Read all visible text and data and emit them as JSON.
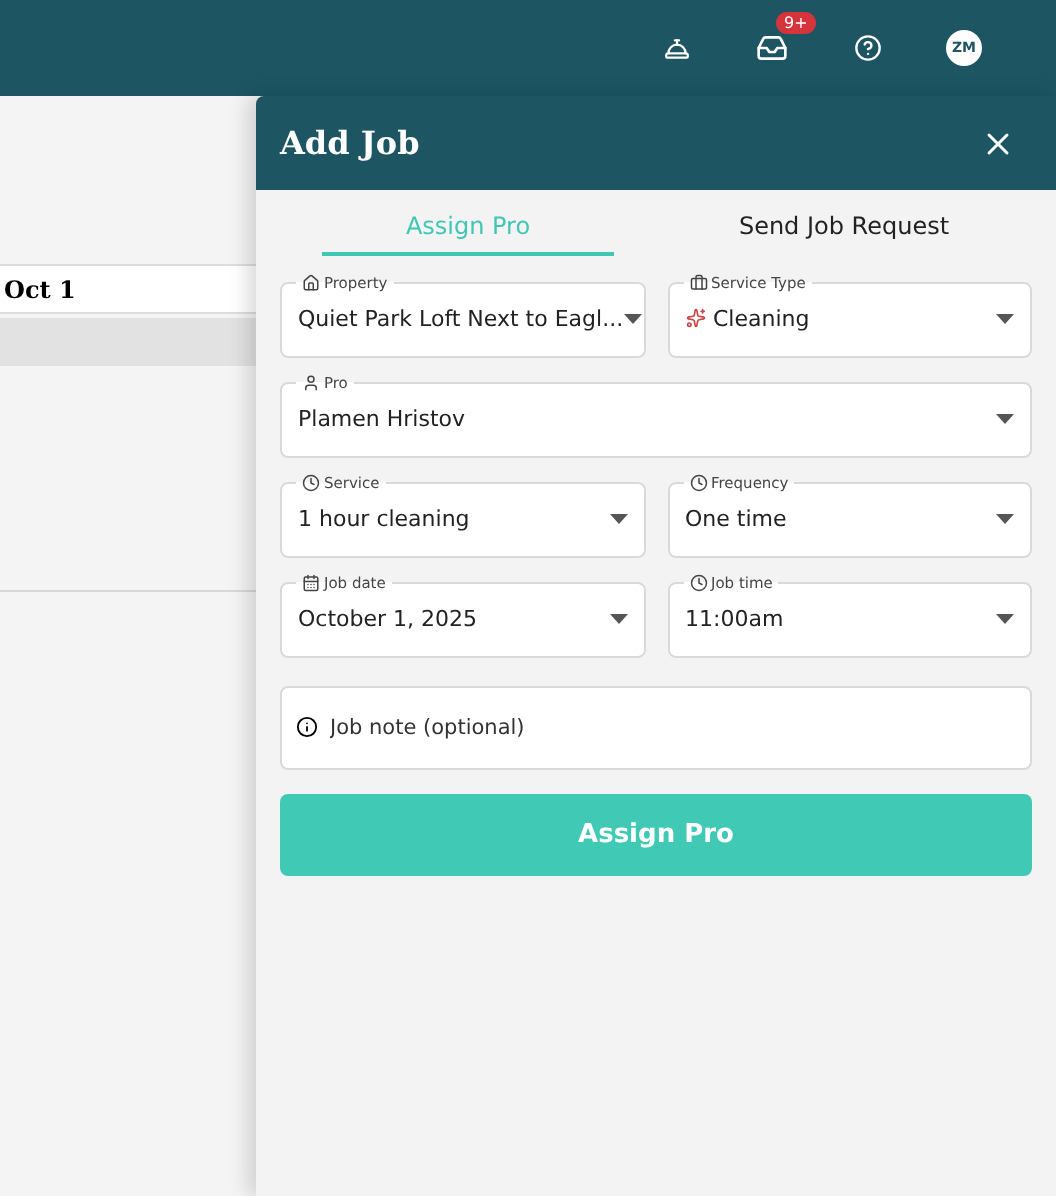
{
  "topbar": {
    "inbox_badge": "9+",
    "avatar": "ZM"
  },
  "background": {
    "column_heading": "Oct 1"
  },
  "drawer": {
    "title": "Add Job",
    "tabs": [
      {
        "label": "Assign Pro",
        "selected": true
      },
      {
        "label": "Send Job Request",
        "selected": false
      }
    ],
    "rows": [
      [
        {
          "kind": "select",
          "label": "Property",
          "value": "Quiet Park Loft Next to Eagl..."
        },
        {
          "kind": "select",
          "label": "Service Type",
          "value": "Cleaning"
        }
      ],
      [
        {
          "kind": "select",
          "label": "Pro",
          "value": "Plamen Hristov"
        }
      ],
      [
        {
          "kind": "select",
          "label": "Service",
          "value": "1 hour cleaning"
        },
        {
          "kind": "select",
          "label": "Frequency",
          "value": "One time"
        }
      ],
      [
        {
          "kind": "select",
          "label": "Job date",
          "value": "October 1, 2025"
        },
        {
          "kind": "select",
          "label": "Job time",
          "value": "11:00am"
        }
      ],
      [
        {
          "kind": "text",
          "placeholder": "Job note (optional)"
        }
      ]
    ],
    "submit": "Assign Pro"
  }
}
